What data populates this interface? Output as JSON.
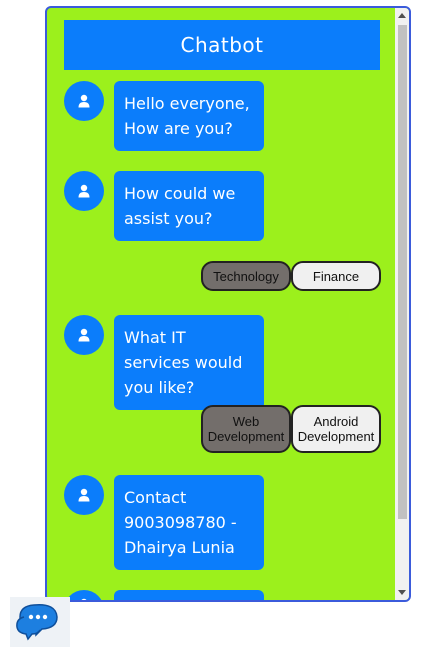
{
  "header": {
    "title": "Chatbot"
  },
  "messages": [
    {
      "text": "Hello everyone, How are you?"
    },
    {
      "text": "How could we assist you?"
    },
    {
      "text": "What IT services would you like?"
    },
    {
      "text": "Contact 9003098780 - Dhairya Lunia"
    }
  ],
  "options_row_1": [
    {
      "label": "Technology",
      "state": "selected"
    },
    {
      "label": "Finance",
      "state": "unselected"
    }
  ],
  "options_row_2": [
    {
      "label": "Web Development",
      "state": "selected"
    },
    {
      "label": "Android Development",
      "state": "unselected"
    }
  ],
  "colors": {
    "panel_background": "#9cf01c",
    "accent": "#0b7dfb",
    "selected_option": "#736e6b",
    "unselected_option": "#f0f0f0"
  },
  "icons": {
    "avatar": "user-icon",
    "launcher": "chat-bubbles-icon"
  }
}
